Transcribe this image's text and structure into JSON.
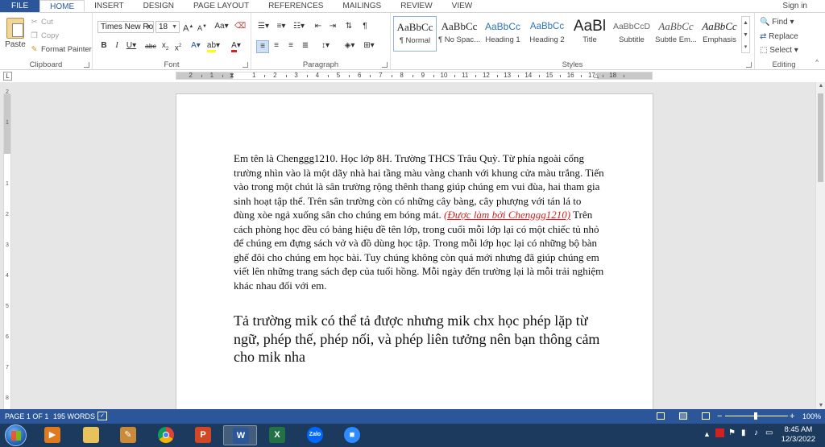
{
  "tabs": {
    "file": "FILE",
    "items": [
      "HOME",
      "INSERT",
      "DESIGN",
      "PAGE LAYOUT",
      "REFERENCES",
      "MAILINGS",
      "REVIEW",
      "VIEW"
    ],
    "signin": "Sign in"
  },
  "clipboard": {
    "paste": "Paste",
    "cut": "Cut",
    "copy": "Copy",
    "format_painter": "Format Painter",
    "label": "Clipboard"
  },
  "font": {
    "family": "Times New Ro",
    "size": "18",
    "label": "Font"
  },
  "paragraph": {
    "label": "Paragraph"
  },
  "styles": {
    "label": "Styles",
    "items": [
      {
        "sample": "AaBbCc",
        "name": "¶ Normal"
      },
      {
        "sample": "AaBbCc",
        "name": "¶ No Spac..."
      },
      {
        "sample": "AaBbCc",
        "name": "Heading 1"
      },
      {
        "sample": "AaBbCc",
        "name": "Heading 2"
      },
      {
        "sample": "AaBl",
        "name": "Title"
      },
      {
        "sample": "AaBbCcD",
        "name": "Subtitle"
      },
      {
        "sample": "AaBbCc",
        "name": "Subtle Em..."
      },
      {
        "sample": "AaBbCc",
        "name": "Emphasis"
      }
    ]
  },
  "editing": {
    "find": "Find",
    "replace": "Replace",
    "select": "Select",
    "label": "Editing"
  },
  "ruler": {
    "numbers": [
      "2",
      "1",
      "1",
      "2",
      "3",
      "4",
      "5",
      "6",
      "7",
      "8",
      "9",
      "10",
      "11",
      "12",
      "13",
      "14",
      "15",
      "16",
      "17",
      "18"
    ]
  },
  "vruler": {
    "numbers": [
      "2",
      "1",
      "1",
      "2",
      "3",
      "4",
      "5",
      "6",
      "7",
      "8"
    ]
  },
  "document": {
    "para1_a": "Em tên là Chenggg1210. Học lớp 8H. Trường THCS Trâu Quỳ. Từ phía ngoài cổng trường nhìn vào là một dãy nhà hai tầng màu vàng chanh với khung cửa màu trắng. Tiến vào trong một chút là sân trường rộng thênh thang giúp chúng em vui đùa, hai tham gia sinh hoạt tập thể. Trên sân trường còn có những cây bàng, cây phượng với tán lá to đùng xòe ngả xuống sân cho chúng em bóng mát.",
    "credit": "(Được làm bởi Chenggg1210)",
    "para1_b": " Trên cách phòng học đều có bảng hiệu đề tên lớp, trong cuối mỗi lớp lại có một chiếc tủ nhỏ để chúng em đựng sách vở và đồ dùng học tập. Trong mỗi lớp học lại có những bộ bàn ghế đôi cho chúng em học bài. Tuy chúng không còn quá mới nhưng đã giúp chúng em viết lên những trang sách đẹp của tuổi hồng. Mỗi ngày đến trường lại là mỗi trải nghiệm khác nhau đối với em.",
    "para2": "Tả trường mik có thể tả được nhưng mik chx học phép lặp từ ngữ, phép thế, phép nối, và phép liên tưởng nên bạn thông cảm cho mik nha"
  },
  "status": {
    "page": "PAGE 1 OF 1",
    "words": "195 WORDS",
    "zoom": "100%"
  },
  "taskbar": {
    "time": "8:45 AM",
    "date": "12/3/2022",
    "apps": [
      "media-player",
      "file-explorer",
      "paint",
      "chrome",
      "powerpoint",
      "word",
      "excel",
      "zalo",
      "zoom"
    ]
  },
  "colors": {
    "accent": "#2b579a",
    "credit_red": "#d42020",
    "taskbar": "#1c3a5e"
  }
}
